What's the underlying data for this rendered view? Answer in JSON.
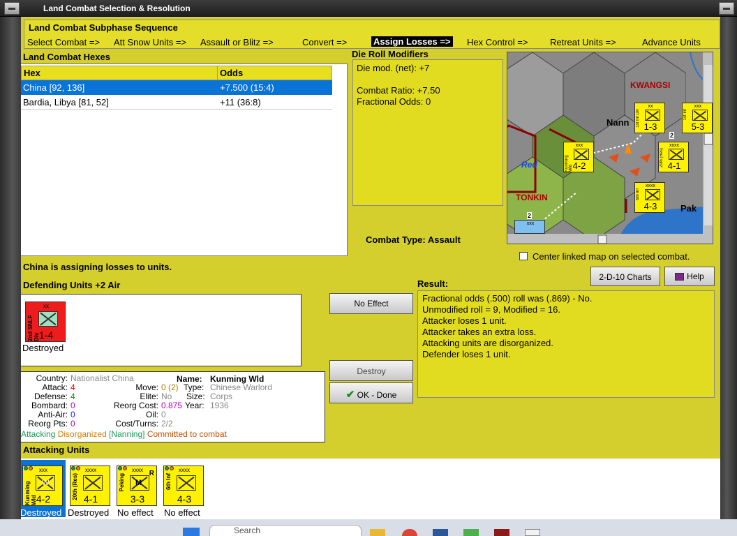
{
  "window": {
    "title": "Land Combat Selection & Resolution"
  },
  "subphase": {
    "title": "Land Combat Subphase Sequence",
    "steps": [
      {
        "label": "Select Combat =>",
        "active": false
      },
      {
        "label": "Att Snow Units =>",
        "active": false
      },
      {
        "label": "Assault or Blitz =>",
        "active": false
      },
      {
        "label": "Convert =>",
        "active": false
      },
      {
        "label": "Assign Losses =>",
        "active": true
      },
      {
        "label": "Hex Control =>",
        "active": false
      },
      {
        "label": "Retreat Units =>",
        "active": false
      },
      {
        "label": "Advance Units",
        "active": false
      }
    ]
  },
  "hexes": {
    "title": "Land Combat Hexes",
    "col_hex": "Hex",
    "col_odds": "Odds",
    "rows": [
      {
        "hex": "China [92, 136]",
        "odds": "+7.500 (15:4)",
        "selected": true
      },
      {
        "hex": "Bardia, Libya [81, 52]",
        "odds": "+11 (36:8)",
        "selected": false
      }
    ]
  },
  "modifiers": {
    "title": "Die Roll Modifiers",
    "net": "Die mod. (net): +7",
    "ratio": "Combat Ratio: +7.50",
    "fractional": "Fractional Odds: 0"
  },
  "map": {
    "labels": {
      "kwangsi": "KWANGSI",
      "nann": "Nann",
      "red": "Red",
      "tonkin": "TONKIN",
      "pak": "Pak"
    },
    "units": [
      {
        "top": "xx",
        "side": "1st Inf Div",
        "val": "1-3"
      },
      {
        "top": "xxx",
        "side": "1st Inf",
        "val": "5-3"
      },
      {
        "top": "xxx",
        "side": "Kunming Wld",
        "val": "4-2"
      },
      {
        "top": "xxxx",
        "side": "20th (Res)",
        "val": "4-1"
      },
      {
        "top": "xxxx",
        "side": "6th Inf",
        "val": "4-3"
      },
      {
        "top": "xxx",
        "side": "",
        "val": ""
      }
    ],
    "badges": [
      "2",
      "2"
    ]
  },
  "combat_type": "Combat Type:  Assault",
  "center_map": "Center linked map on selected combat.",
  "status_message": "China is assigning losses to units.",
  "buttons": {
    "charts": "2-D-10 Charts",
    "help": "Help",
    "no_effect": "No Effect",
    "destroy": "Destroy",
    "ok_done": "OK - Done"
  },
  "defending": {
    "title": "Defending Units +2 Air",
    "units": [
      {
        "top": "xx",
        "side": "2nd SNLF Div",
        "val": "1-4",
        "status": "Destroyed",
        "color": "#ee1c1c"
      }
    ]
  },
  "result": {
    "title": "Result:",
    "lines": [
      "Fractional odds (.500) roll was (.869)  - No.",
      "Unmodified roll = 9, Modified = 16.",
      "Attacker loses 1 unit.",
      "Attacker takes an extra loss.",
      "Attacking units are disorganized.",
      "Defender loses 1 unit."
    ]
  },
  "unit_info": {
    "country_label": "Country:",
    "country": "Nationalist China",
    "name_label": "Name:",
    "name": "Kunming Wld",
    "attack_label": "Attack:",
    "attack": "4",
    "move_label": "Move:",
    "move": "0 (2)",
    "type_label": "Type:",
    "type": "Chinese Warlord",
    "defense_label": "Defense:",
    "defense": "4",
    "elite_label": "Elite:",
    "elite": "No",
    "size_label": "Size:",
    "size": "Corps",
    "bombard_label": "Bombard:",
    "bombard": "0",
    "reorg_cost_label": "Reorg Cost:",
    "reorg_cost": "0.875",
    "year_label": "Year:",
    "year": "1936",
    "antiair_label": "Anti-Air:",
    "antiair": "0",
    "oil_label": "Oil:",
    "oil": "0",
    "reorg_pts_label": "Reorg Pts:",
    "reorg_pts": "0",
    "cost_turns_label": "Cost/Turns:",
    "cost_turns": "2/2",
    "status_attacking": "Attacking",
    "status_disorganized": "Disorganized",
    "status_location": "[Nanning]",
    "status_committed": "Committed to combat"
  },
  "attacking": {
    "title": "Attacking Units",
    "units": [
      {
        "top": "xxx",
        "side": "Kunming Wld",
        "val": "4-2",
        "mark": "W",
        "corner": "",
        "status": "Destroyed",
        "selected": true
      },
      {
        "top": "xxxx",
        "side": "20th (Res)",
        "val": "4-1",
        "mark": "",
        "corner": "",
        "status": "Destroyed",
        "selected": false
      },
      {
        "top": "xxxx",
        "side": "Peking",
        "val": "3-3",
        "mark": "M",
        "corner": "R",
        "status": "No effect",
        "selected": false
      },
      {
        "top": "xxxx",
        "side": "6th Inf",
        "val": "4-3",
        "mark": "",
        "corner": "",
        "status": "No effect",
        "selected": false
      }
    ]
  },
  "taskbar": {
    "search": "Search"
  },
  "colors": {
    "panel": "#d4cf2c",
    "select": "#0a74d6",
    "counter": "#fff200",
    "defender": "#ee1c1c"
  }
}
